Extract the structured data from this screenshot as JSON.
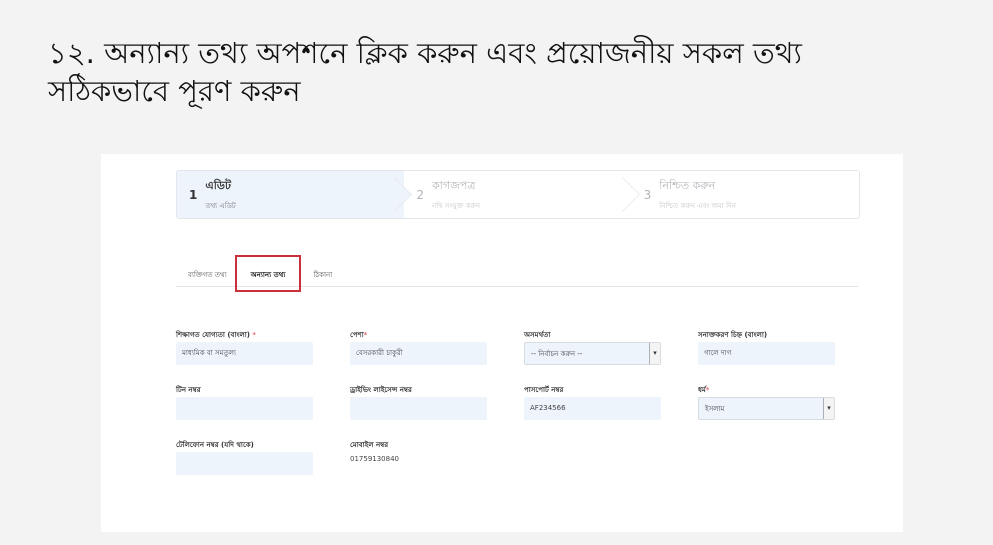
{
  "instruction": {
    "line1": "১২. অন্যান্য তথ্য অপশনে ক্লিক করুন এবং প্রয়োজনীয় সকল তথ্য",
    "line2": "সঠিকভাবে পূরণ করুন"
  },
  "stepper": {
    "steps": [
      {
        "num": "1",
        "title": "এডিট",
        "sub": "তথ্য এডিট"
      },
      {
        "num": "2",
        "title": "কাগজপত্র",
        "sub": "নথি সংযুক্ত করুন"
      },
      {
        "num": "3",
        "title": "নিশ্চিত করুন",
        "sub": "নিশ্চিত করুন এবং জমা দিন"
      }
    ]
  },
  "tabs": [
    "ব্যক্তিগত তথ্য",
    "অন্যান্য তথ্য",
    "ঠিকানা"
  ],
  "form": {
    "education_label": "শিক্ষাগত যোগ্যতা (বাংলা)",
    "education_value": "মাধ্যমিক বা সমতুল্য",
    "occupation_label": "পেশা",
    "occupation_value": "বেসরকারী চাকুরী",
    "disability_label": "অসমর্থতা",
    "disability_value": "-- নির্বাচন করুন --",
    "identity_mark_label": "সনাক্তকরণ চিহ্ন (বাংলা)",
    "identity_mark_value": "গালে দাগ",
    "tin_label": "টিন নম্বর",
    "tin_value": "",
    "driving_label": "ড্রাইভিং লাইসেন্স নম্বর",
    "driving_value": "",
    "passport_label": "পাসপোর্ট নম্বর",
    "passport_value": "AF234566",
    "religion_label": "ধর্ম",
    "religion_value": "ইসলাম",
    "telephone_label": "টেলিফোন নম্বর (যদি থাকে)",
    "telephone_value": "",
    "mobile_label": "মোবাইল নম্বর",
    "mobile_value": "01759130840",
    "required_mark": "*",
    "dropdown_arrow": "▾"
  },
  "colors": {
    "field_bg": "#eef4fc",
    "highlight": "#c8313b",
    "required": "#d0342c"
  }
}
